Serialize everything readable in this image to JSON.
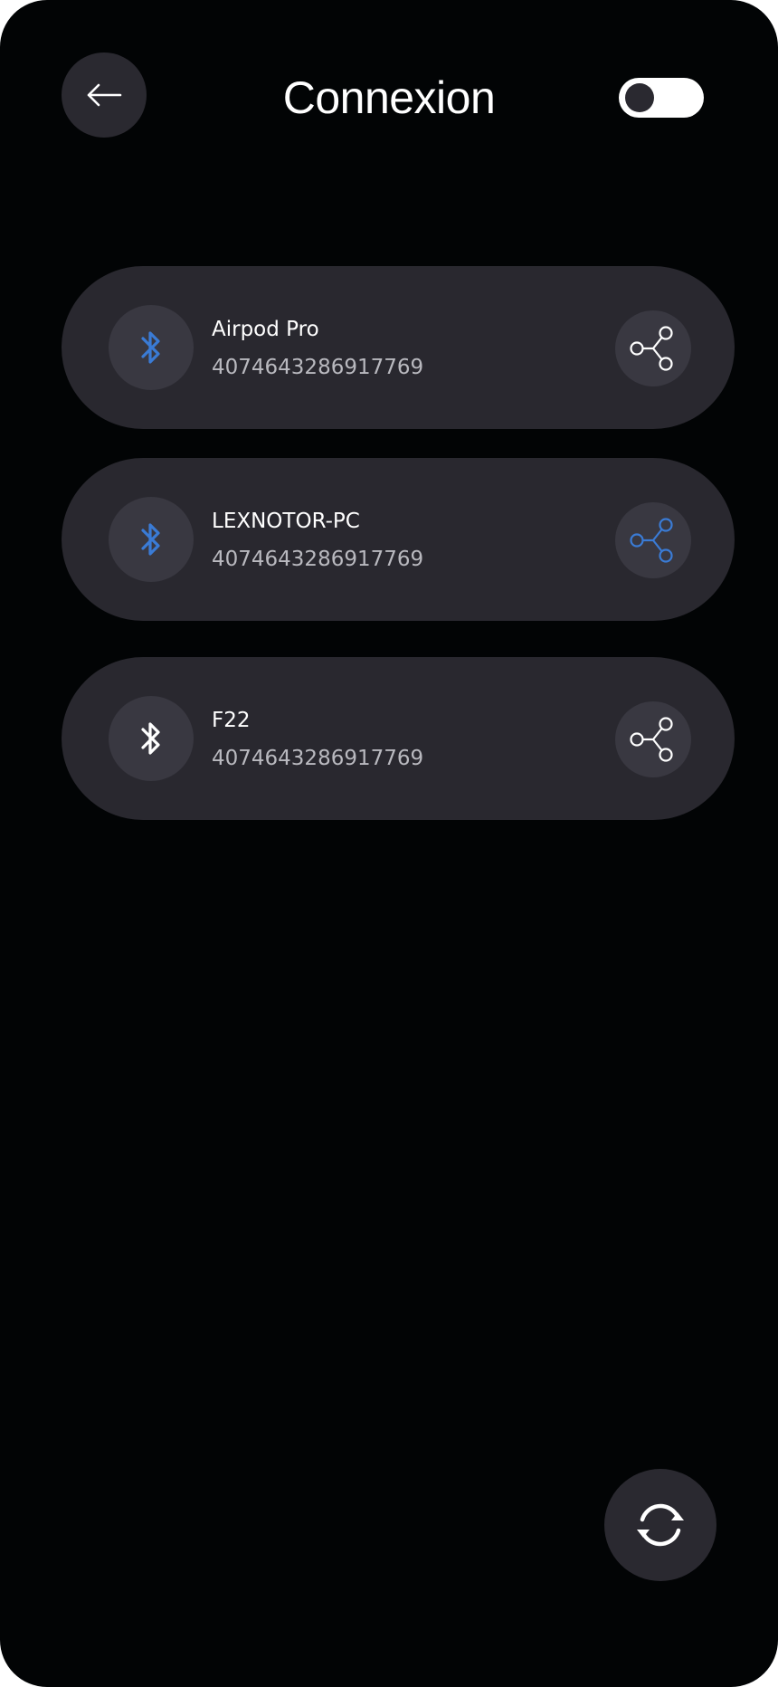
{
  "header": {
    "title": "Connexion",
    "back_icon": "arrow-left-icon",
    "toggle_on": false
  },
  "colors": {
    "background": "#020405",
    "card": "#29282f",
    "badge": "#393841",
    "accent_blue": "#3a7bd5",
    "text_primary": "#ffffff",
    "text_secondary": "#b9b9bf"
  },
  "devices": [
    {
      "name": "Airpod Pro",
      "id": "4074643286917769",
      "bluetooth_icon_color": "#3a7bd5",
      "share_icon_color": "#ffffff"
    },
    {
      "name": "LEXNOTOR-PC",
      "id": "4074643286917769",
      "bluetooth_icon_color": "#3a7bd5",
      "share_icon_color": "#3a7bd5"
    },
    {
      "name": "F22",
      "id": "4074643286917769",
      "bluetooth_icon_color": "#ffffff",
      "share_icon_color": "#ffffff"
    }
  ],
  "fab": {
    "icon": "refresh-icon"
  }
}
